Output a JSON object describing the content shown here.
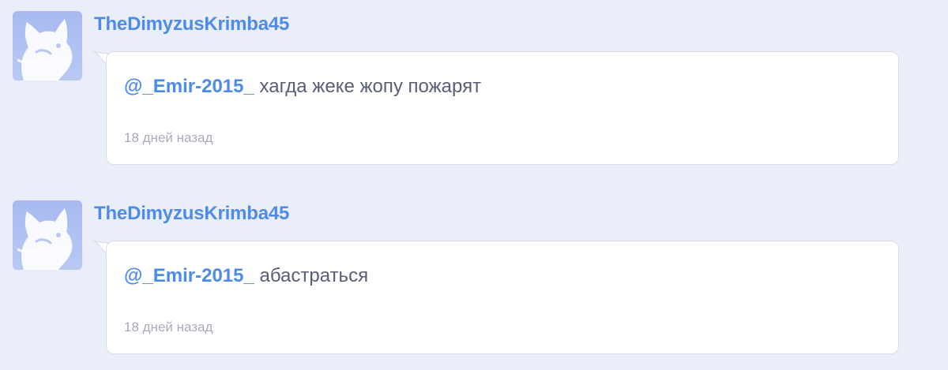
{
  "comments": [
    {
      "username": "TheDimyzusKrimba45",
      "mention": "@_Emir-2015_",
      "text": "хагда жеке жопу пожарят",
      "time": "18 дней назад",
      "avatar_icon": "scratch-cat-default-avatar-icon"
    },
    {
      "username": "TheDimyzusKrimba45",
      "mention": "@_Emir-2015_",
      "text": "абастраться",
      "time": "18 дней назад",
      "avatar_icon": "scratch-cat-default-avatar-icon"
    }
  ],
  "colors": {
    "background": "#e9eef9",
    "username": "#4d8be8",
    "text": "#575e75",
    "time": "#a7acb8",
    "avatar_bg": "#a7baf0"
  }
}
